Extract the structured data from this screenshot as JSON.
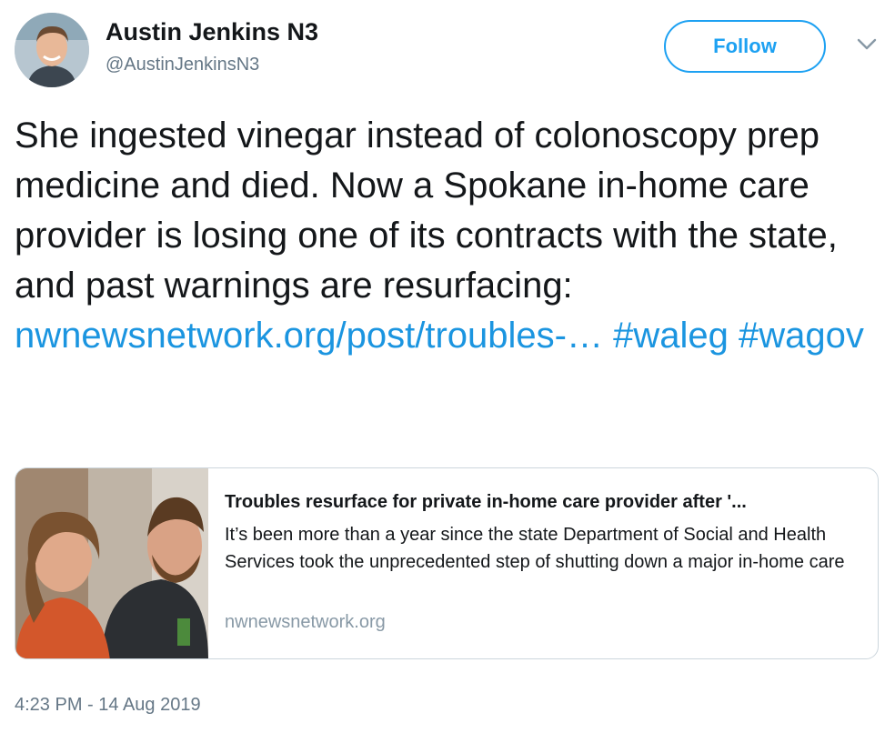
{
  "author": {
    "name": "Austin Jenkins N3",
    "handle": "@AustinJenkinsN3"
  },
  "follow_button": {
    "label": "Follow"
  },
  "tweet": {
    "text_part1": "She ingested vinegar instead of colonoscopy prep medicine and died. Now a Spokane in-home care provider is losing one of its contracts with the state, and past warnings are resurfacing:",
    "link": "nwnewsnetwork.org/post/troubles-…",
    "hashtag1": "#waleg",
    "hashtag2": "#wagov"
  },
  "card": {
    "title": "Troubles resurface for private in-home care provider after '...",
    "description": "It’s been more than a year since the state Department of Social and Health Services took the unprecedented step of shutting down a major in-home care",
    "domain": "nwnewsnetwork.org"
  },
  "timestamp": "4:23 PM - 14 Aug 2019",
  "colors": {
    "accent": "#1da1f2",
    "link": "#1b95e0",
    "secondary_text": "#657786",
    "border": "#ccd6dd"
  },
  "icons": {
    "more": "chevron-down-icon"
  }
}
